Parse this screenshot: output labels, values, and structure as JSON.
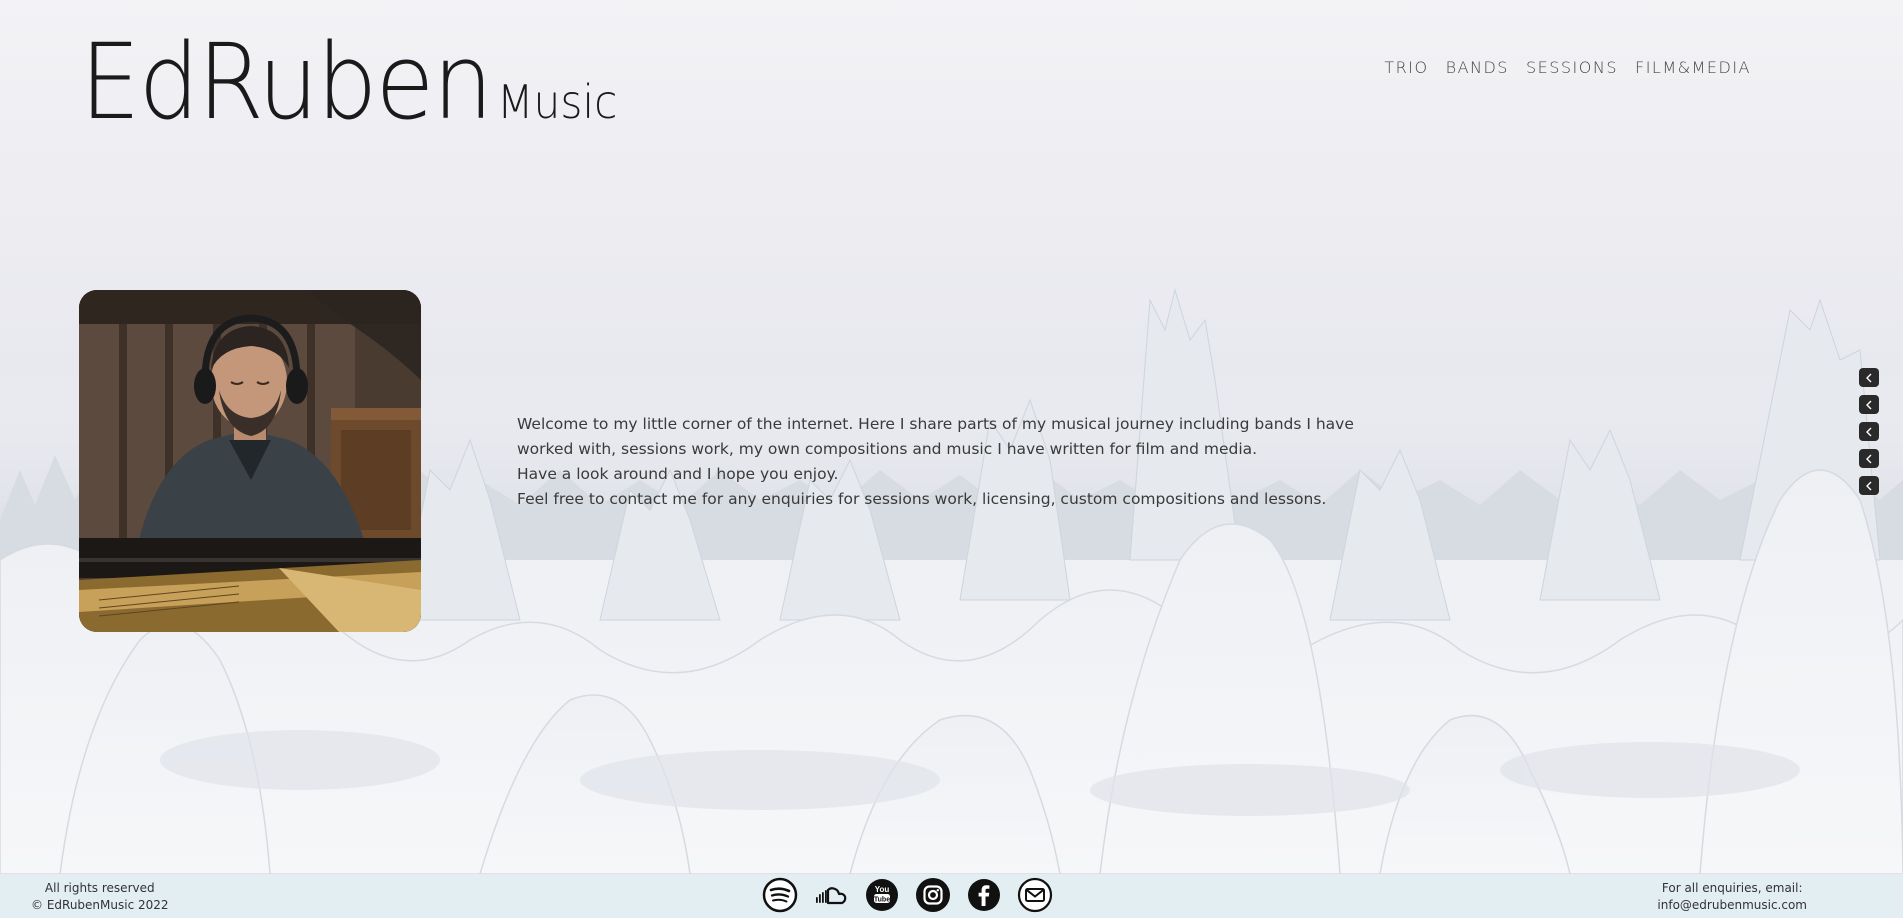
{
  "logo": {
    "main": "EdRuben",
    "sub": "Music"
  },
  "nav": {
    "items": [
      "TRIO",
      "BANDS",
      "SESSIONS",
      "FILM&MEDIA"
    ]
  },
  "intro": {
    "paragraphs": [
      "Welcome to my little corner of the internet. Here I share parts of my musical journey including bands I have worked with, sessions work, my own compositions and music I have written for film and media.",
      "Have a look around and I hope you enjoy.",
      "Feel free to contact me for any enquiries for sessions work, licensing, custom compositions and lessons."
    ]
  },
  "side_nav": {
    "icons": [
      "chevron-left-icon",
      "chevron-left-icon",
      "chevron-left-icon",
      "chevron-left-icon",
      "chevron-left-icon"
    ]
  },
  "footer": {
    "rights": "All rights reserved",
    "copyright": "© EdRubenMusic 2022",
    "contact_label": "For all enquiries, email:",
    "email": "info@edrubenmusic.com",
    "social_icons": [
      "spotify-icon",
      "soundcloud-icon",
      "youtube-icon",
      "instagram-icon",
      "facebook-icon",
      "email-icon"
    ]
  },
  "colors": {
    "text_dark": "#1a1a1a",
    "footer_bg": "#e3eef3",
    "side_dot": "#2a2a2a"
  }
}
